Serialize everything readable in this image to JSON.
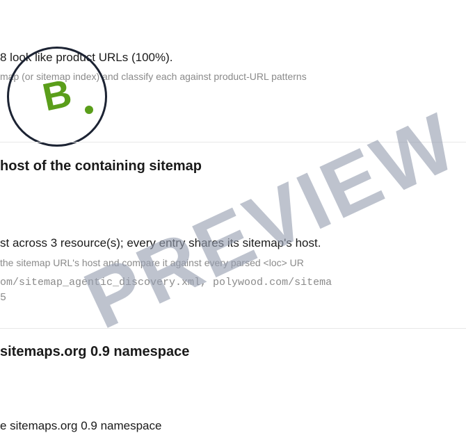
{
  "section1": {
    "result": "8 look like product URLs (100%).",
    "description": "map (or sitemap index) and classify each against product-URL patterns"
  },
  "badge": {
    "letter": "B"
  },
  "section2": {
    "heading": "host of the containing sitemap",
    "result": "st across 3 resource(s); every entry shares its sitemap's host.",
    "description": "the sitemap URL's host and compare it against every parsed <loc> UR",
    "resources": "om/sitemap_agentic_discovery.xml, polywood.com/sitema",
    "resources_tail": "5"
  },
  "section3": {
    "heading": "sitemaps.org 0.9 namespace",
    "result": "e sitemaps.org 0.9 namespace"
  },
  "watermark": {
    "text": "PREVIEW"
  },
  "colors": {
    "accent_green": "#5a9e1a",
    "badge_ring": "#1c2333",
    "muted_text": "#8a8a8a",
    "watermark": "#969eb0"
  }
}
